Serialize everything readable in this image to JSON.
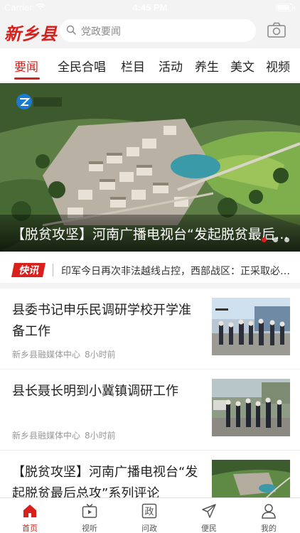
{
  "status_bar": {
    "carrier": "Carrier",
    "time": "4:45 PM"
  },
  "header": {
    "logo": "新乡县",
    "search_placeholder": "党政要闻",
    "icons": [
      "search-icon",
      "camera-icon"
    ]
  },
  "tabs": [
    "要闻",
    "全民合唱",
    "栏目",
    "活动",
    "养生",
    "美文",
    "视频"
  ],
  "active_tab": "要闻",
  "banner": {
    "channel_logo": "河南卫视",
    "caption": "【脱贫攻坚】河南广播电视台“发起脱贫最后总攻”系列评论",
    "slide_count": 3,
    "active_slide": 1
  },
  "flash": {
    "badge": "快讯",
    "text": "印军今日再次非法越线占控，西部战区：正采取必要措施应对"
  },
  "news": [
    {
      "title": "县委书记申乐民调研学校开学准备工作",
      "source": "新乡县融媒体中心",
      "time": "8小时前"
    },
    {
      "title": "县长聂长明到小冀镇调研工作",
      "source": "新乡县融媒体中心",
      "time": "8小时前"
    },
    {
      "title": "【脱贫攻坚】河南广播电视台“发起脱贫最后总攻”系列评论",
      "source": "",
      "time": ""
    }
  ],
  "bottom_nav": [
    {
      "label": "首页",
      "icon": "home-icon",
      "active": true
    },
    {
      "label": "视听",
      "icon": "tv-icon",
      "active": false
    },
    {
      "label": "问政",
      "icon": "politics-icon",
      "active": false
    },
    {
      "label": "便民",
      "icon": "send-icon",
      "active": false
    },
    {
      "label": "我的",
      "icon": "user-icon",
      "active": false
    }
  ],
  "colors": {
    "accent": "#d8201c",
    "header_bg": "#f3f3f3"
  }
}
